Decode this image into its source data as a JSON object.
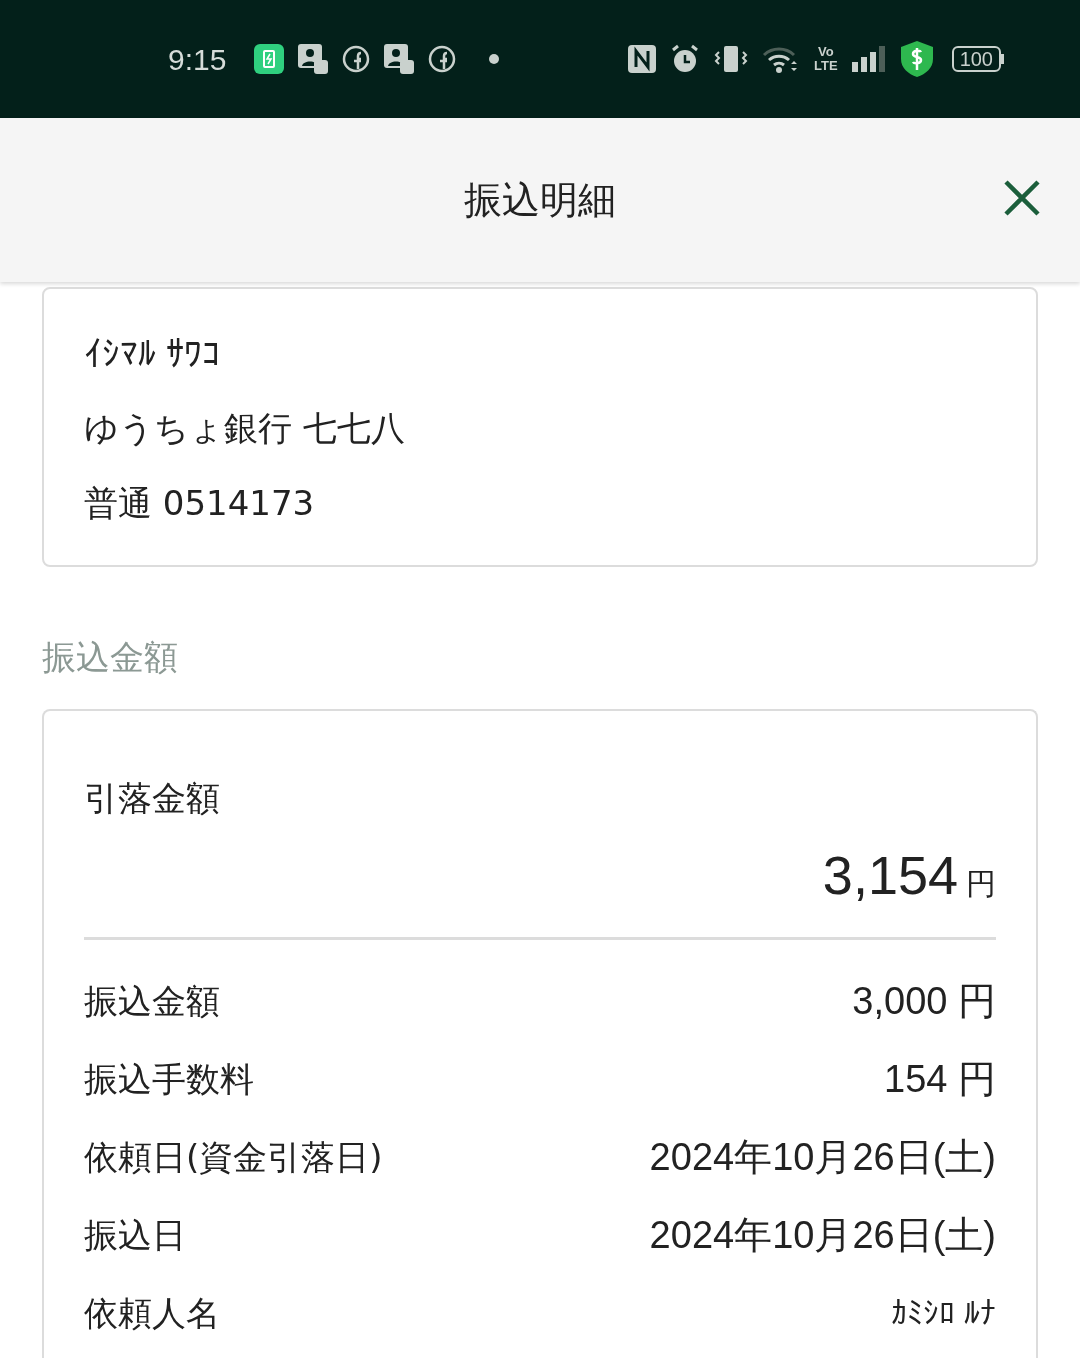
{
  "status_bar": {
    "time": "9:15",
    "volte": [
      "Vo",
      "LTE"
    ],
    "battery": "100"
  },
  "header": {
    "title": "振込明細"
  },
  "recipient": {
    "name": "ｲｼﾏﾙ ｻﾜｺ",
    "bank": "ゆうちょ銀行 七七八",
    "account": "普通 0514173"
  },
  "amount_section": {
    "label": "振込金額",
    "total_label": "引落金額",
    "total_value": "3,154",
    "total_unit": "円",
    "rows": [
      {
        "label": "振込金額",
        "value": "3,000 円",
        "kind": "number"
      },
      {
        "label": "振込手数料",
        "value": "154 円",
        "kind": "number"
      },
      {
        "label": "依頼日(資金引落日)",
        "value": "2024年10月26日(土)",
        "kind": "number"
      },
      {
        "label": "振込日",
        "value": "2024年10月26日(土)",
        "kind": "number"
      },
      {
        "label": "依頼人名",
        "value": "ｶﾐｼﾛ ﾙﾅ",
        "kind": "kana"
      }
    ]
  }
}
